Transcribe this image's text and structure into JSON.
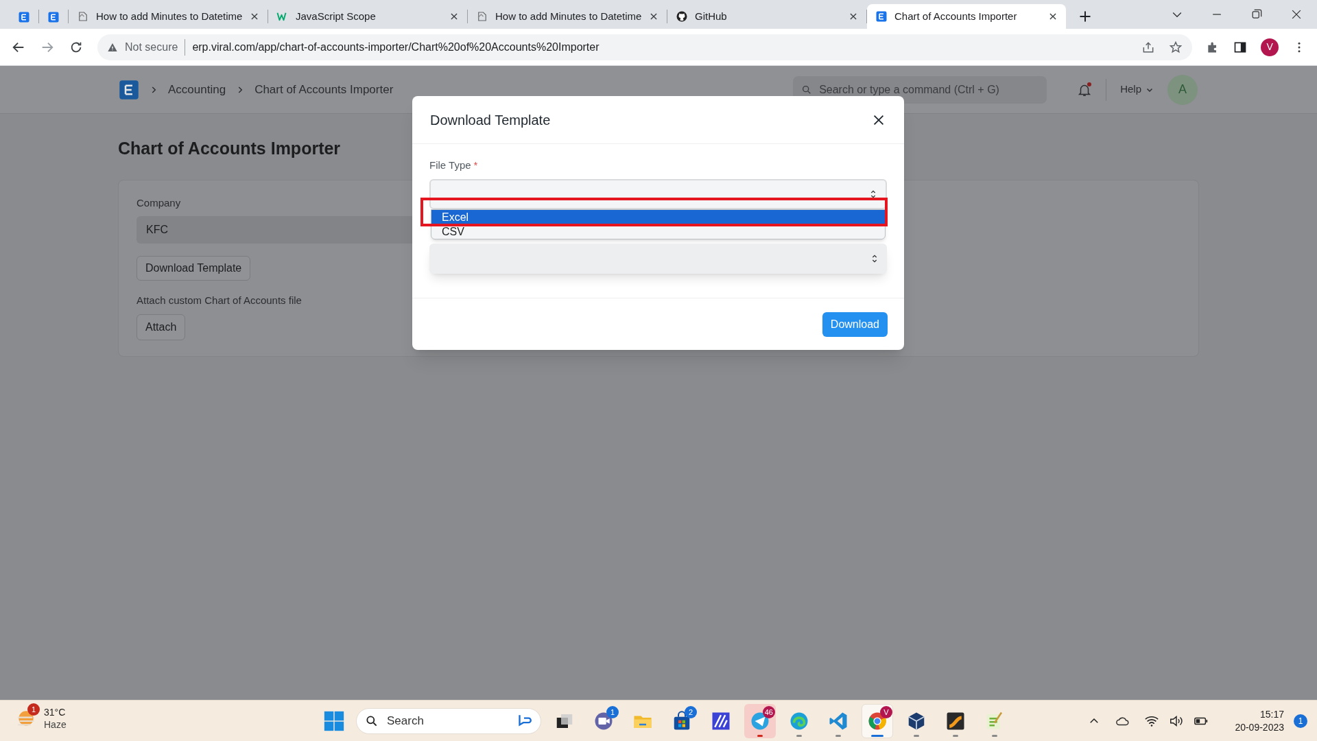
{
  "browser": {
    "tabs": [
      {
        "kind": "erp",
        "selected": false
      },
      {
        "kind": "erp",
        "selected": false
      },
      {
        "kind": "page",
        "title": "How to add Minutes to Datetime",
        "selected": false
      },
      {
        "kind": "w3",
        "title": "JavaScript Scope",
        "selected": false
      },
      {
        "kind": "page",
        "title": "How to add Minutes to Datetime",
        "selected": false
      },
      {
        "kind": "github",
        "title": "GitHub",
        "selected": false
      },
      {
        "kind": "erp",
        "title": "Chart of Accounts Importer",
        "selected": true
      }
    ],
    "security": "Not secure",
    "url": "erp.viral.com/app/chart-of-accounts-importer/Chart%20of%20Accounts%20Importer",
    "profile": "V"
  },
  "navbar": {
    "breadcrumbs": [
      "Accounting",
      "Chart of Accounts Importer"
    ],
    "search": {
      "placeholder": "Search or type a command (Ctrl + G)"
    },
    "help": "Help",
    "avatar": "A",
    "unread": true
  },
  "page": {
    "title": "Chart of Accounts Importer",
    "company": {
      "label": "Company",
      "value": "KFC"
    },
    "download_template": "Download Template",
    "attach_label": "Attach custom Chart of Accounts file",
    "attach": "Attach"
  },
  "dialog": {
    "title": "Download Template",
    "file_type": {
      "label": "File Type",
      "required_mark": "*",
      "options": [
        {
          "label": "Excel",
          "selected": true
        },
        {
          "label": "CSV",
          "selected": false
        }
      ]
    },
    "button": "Download"
  },
  "taskbar": {
    "weather": {
      "temperature": "31°C",
      "condition": "Haze",
      "badge": "1"
    },
    "search": {
      "placeholder": "Search"
    },
    "apps": [
      {
        "kind": "taskview",
        "running": false,
        "flashing": false,
        "selected": false
      },
      {
        "kind": "chat",
        "running": false,
        "flashing": false,
        "selected": false,
        "badge": "1"
      },
      {
        "kind": "folder",
        "running": false,
        "flashing": false,
        "selected": false
      },
      {
        "kind": "store",
        "running": false,
        "flashing": false,
        "selected": false,
        "badge": "2"
      },
      {
        "kind": "pen",
        "running": false,
        "flashing": false,
        "selected": false
      },
      {
        "kind": "telegram",
        "running": true,
        "flashing": true,
        "selected": false,
        "badge": "46"
      },
      {
        "kind": "edge",
        "running": true,
        "flashing": false,
        "selected": false
      },
      {
        "kind": "vscode",
        "running": true,
        "flashing": false,
        "selected": false
      },
      {
        "kind": "chrome",
        "running": true,
        "flashing": false,
        "selected": true,
        "badge": "V"
      },
      {
        "kind": "cube",
        "running": true,
        "flashing": false,
        "selected": false
      },
      {
        "kind": "tool",
        "running": true,
        "flashing": false,
        "selected": false
      },
      {
        "kind": "notepad",
        "running": true,
        "flashing": false,
        "selected": false
      }
    ],
    "time": "15:17",
    "date": "20-09-2023",
    "notifications": "1"
  }
}
